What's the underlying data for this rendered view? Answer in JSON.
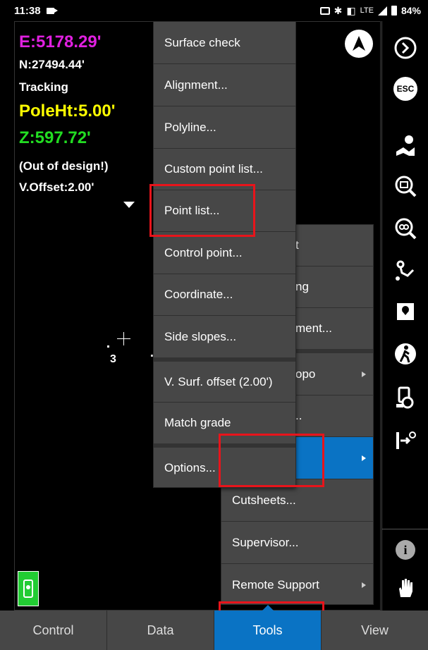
{
  "status_bar": {
    "time": "11:38",
    "indicators": "LTE",
    "battery": "84%"
  },
  "readouts": {
    "easting": "E:5178.29'",
    "northing": "N:27494.44'",
    "mode": "Tracking",
    "pole_height": "PoleHt:5.00'",
    "elevation": "Z:597.72'",
    "design_status": "(Out of design!)",
    "v_offset": "V.Offset:2.00'"
  },
  "map": {
    "point_label": "3"
  },
  "colors": {
    "easting": "#e020e0",
    "pole_height": "#ffff00",
    "elevation": "#22dd22",
    "accent": "#0a73c4",
    "highlight": "#e8141b"
  },
  "tools_menu": {
    "items": [
      {
        "label": "t"
      },
      {
        "label": "ng"
      },
      {
        "label": "ment..."
      },
      {
        "label": "opo"
      },
      {
        "label": ".."
      },
      {
        "label": ""
      },
      {
        "label": "Cutsheets..."
      },
      {
        "label": "Supervisor..."
      },
      {
        "label": "Remote Support"
      }
    ]
  },
  "submenu": {
    "items": [
      {
        "label": "Surface check"
      },
      {
        "label": "Alignment..."
      },
      {
        "label": "Polyline..."
      },
      {
        "label": "Custom point list..."
      },
      {
        "label": "Point list..."
      },
      {
        "label": "Control point..."
      },
      {
        "label": "Coordinate..."
      },
      {
        "label": "Side slopes..."
      },
      {
        "label": "V. Surf. offset (2.00')"
      },
      {
        "label": "Match grade"
      },
      {
        "label": "Options..."
      }
    ]
  },
  "toolbar": {
    "icons": [
      "navigate-icon",
      "forward-icon",
      "esc-icon",
      "map-pin-icon",
      "zoom-extents-icon",
      "zoom-fit-icon",
      "route-icon",
      "map-point-icon",
      "walk-icon",
      "instrument-icon",
      "stakeout-icon",
      "info-icon",
      "hand-icon"
    ],
    "esc_label": "ESC"
  },
  "bottom_nav": {
    "tabs": [
      "Control",
      "Data",
      "Tools",
      "View"
    ],
    "active": "Tools"
  }
}
